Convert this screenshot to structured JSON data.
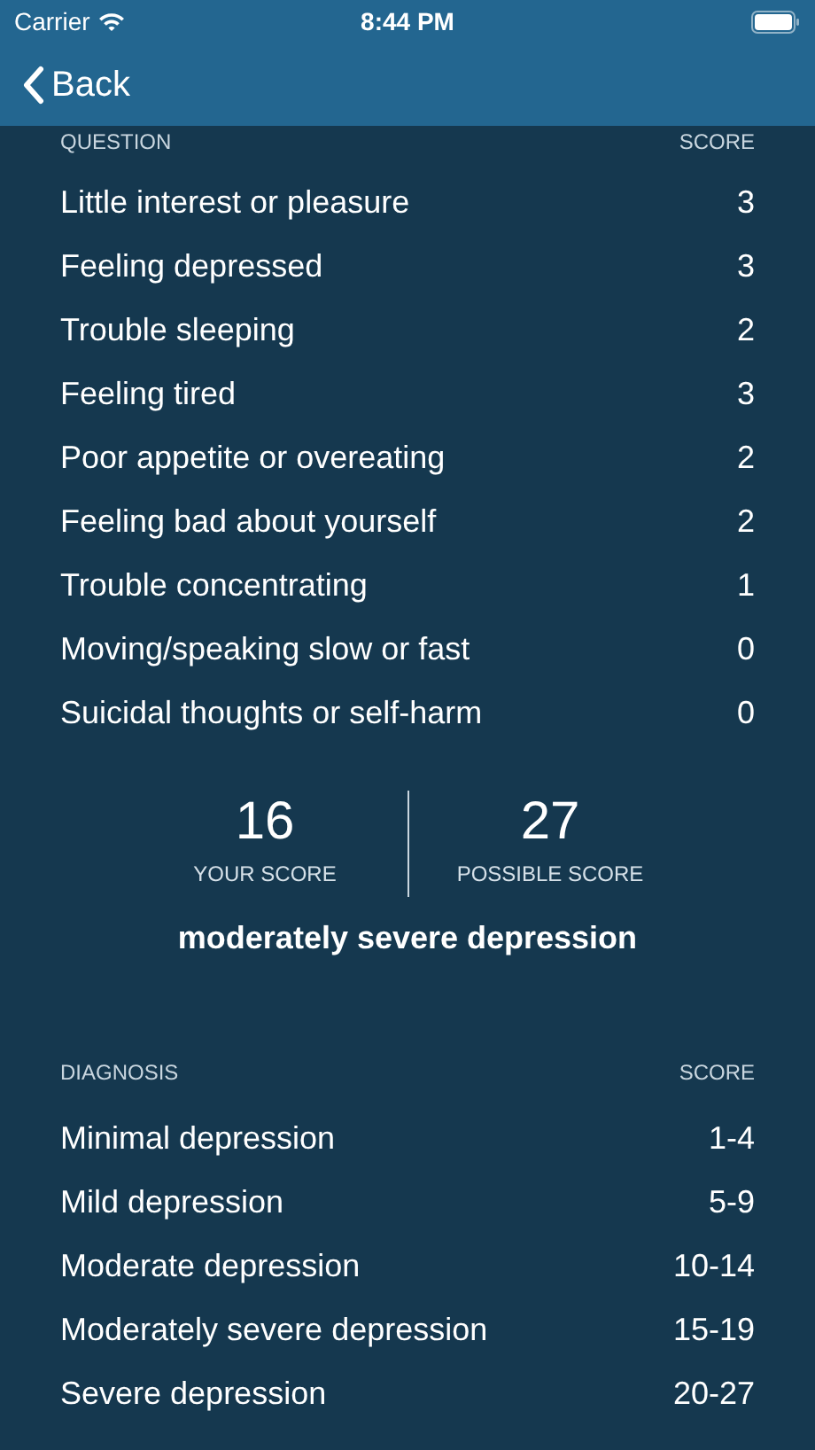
{
  "status_bar": {
    "carrier": "Carrier",
    "time": "8:44 PM"
  },
  "nav": {
    "back": "Back"
  },
  "questions": {
    "columns": [
      "QUESTION",
      "SCORE"
    ],
    "rows": [
      {
        "label": "Little interest or pleasure",
        "score": "3"
      },
      {
        "label": "Feeling depressed",
        "score": "3"
      },
      {
        "label": "Trouble sleeping",
        "score": "2"
      },
      {
        "label": "Feeling tired",
        "score": "3"
      },
      {
        "label": "Poor appetite or overeating",
        "score": "2"
      },
      {
        "label": "Feeling bad about yourself",
        "score": "2"
      },
      {
        "label": "Trouble concentrating",
        "score": "1"
      },
      {
        "label": "Moving/speaking slow or fast",
        "score": "0"
      },
      {
        "label": "Suicidal thoughts or self-harm",
        "score": "0"
      }
    ]
  },
  "summary": {
    "your_score": "16",
    "your_score_label": "YOUR SCORE",
    "possible_score": "27",
    "possible_score_label": "POSSIBLE SCORE",
    "result": "moderately severe depression"
  },
  "diagnosis": {
    "columns": [
      "DIAGNOSIS",
      "SCORE"
    ],
    "rows": [
      {
        "label": "Minimal depression",
        "range": "1-4"
      },
      {
        "label": "Mild depression",
        "range": "5-9"
      },
      {
        "label": "Moderate depression",
        "range": "10-14"
      },
      {
        "label": "Moderately severe depression",
        "range": "15-19"
      },
      {
        "label": "Severe depression",
        "range": "20-27"
      }
    ]
  }
}
